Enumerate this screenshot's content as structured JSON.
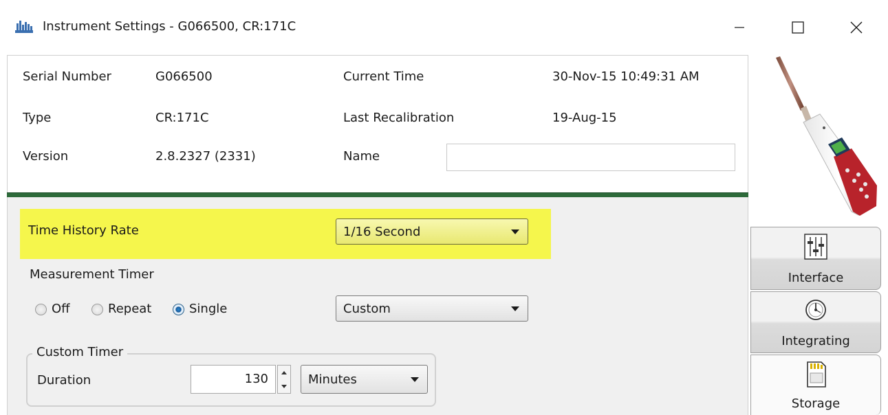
{
  "window": {
    "title": "Instrument Settings - G066500, CR:171C",
    "minimize_glyph": "—",
    "maximize_glyph": "☐",
    "close_glyph": "✕"
  },
  "info": {
    "serial_label": "Serial Number",
    "serial_value": "G066500",
    "type_label": "Type",
    "type_value": "CR:171C",
    "version_label": "Version",
    "version_value": "2.8.2327  (2331)",
    "current_time_label": "Current Time",
    "current_time_value": "30-Nov-15 10:49:31 AM",
    "last_recal_label": "Last Recalibration",
    "last_recal_value": "19-Aug-15",
    "name_label": "Name",
    "name_value": ""
  },
  "settings": {
    "time_history_label": "Time History Rate",
    "time_history_value": "1/16 Second",
    "measurement_timer_label": "Measurement Timer",
    "radio_off": "Off",
    "radio_repeat": "Repeat",
    "radio_single": "Single",
    "timer_mode_value": "Custom",
    "custom_timer_title": "Custom Timer",
    "duration_label": "Duration",
    "duration_value": "130",
    "duration_unit": "Minutes"
  },
  "tabs": {
    "interface": "Interface",
    "integrating": "Integrating",
    "storage": "Storage"
  },
  "colors": {
    "highlight": "#f5f64c",
    "green_bar": "#2d6a3a",
    "device_red": "#b8232b"
  }
}
